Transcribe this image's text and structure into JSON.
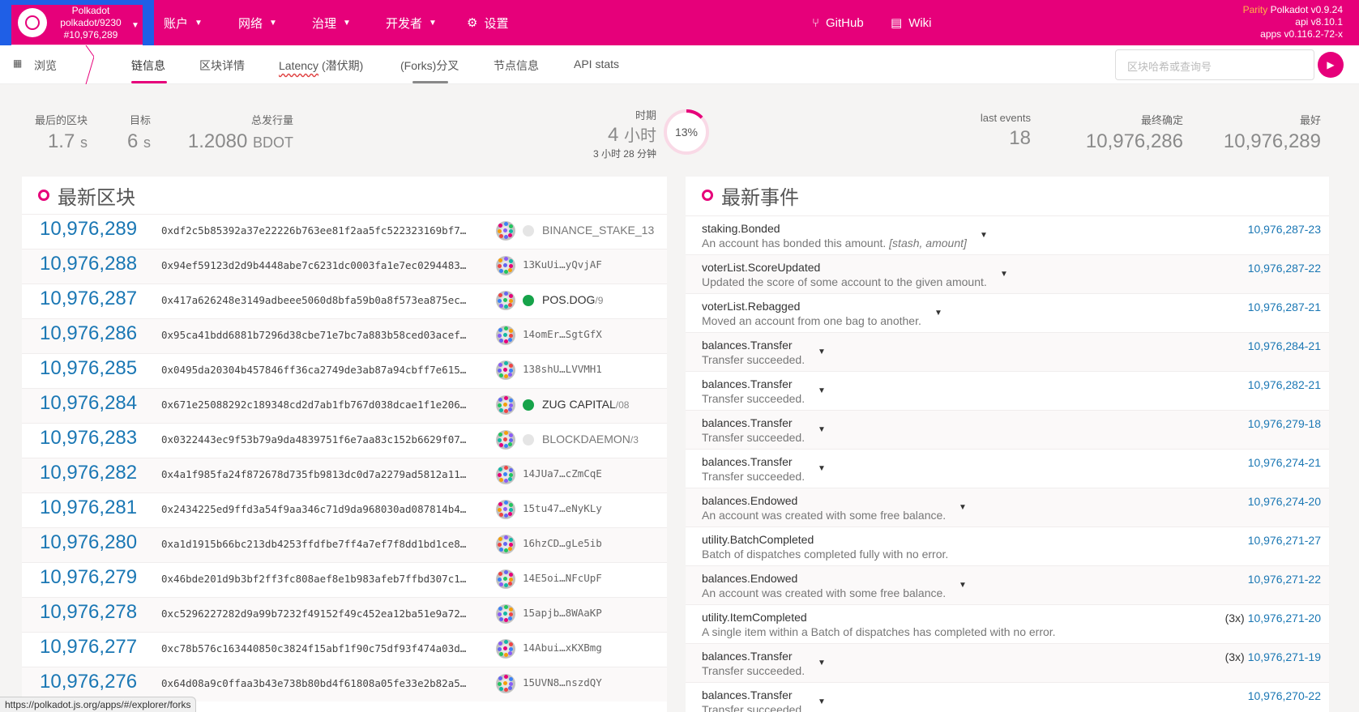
{
  "chain": {
    "name": "Polkadot",
    "endpoint": "polkadot/9230",
    "block": "#10,976,289"
  },
  "nav": {
    "accounts": "账户",
    "network": "网络",
    "governance": "治理",
    "developer": "开发者",
    "settings": "设置",
    "github": "GitHub",
    "wiki": "Wiki"
  },
  "version": {
    "brand": "Parity",
    "node": "Polkadot v0.9.24",
    "api": "api v8.10.1",
    "apps": "apps v0.116.2-72-x"
  },
  "subnav": {
    "browse": "浏览",
    "tabs": [
      {
        "label": "链信息"
      },
      {
        "label": "区块详情"
      },
      {
        "label": "Latency",
        "extra": "(潜伏期)"
      },
      {
        "label": "(Forks)分叉"
      },
      {
        "label": "节点信息"
      },
      {
        "label": "API stats"
      }
    ],
    "search_placeholder": "区块哈希或查询号"
  },
  "summary": {
    "last_block": {
      "label": "最后的区块",
      "value": "1.7",
      "unit": "s"
    },
    "target": {
      "label": "目标",
      "value": "6",
      "unit": "s"
    },
    "issuance": {
      "label": "总发行量",
      "value": "1.2080",
      "unit": "BDOT"
    },
    "era": {
      "label": "时期",
      "value": "4",
      "unit": "小时",
      "sub": "3 小时 28 分钟",
      "percent": 13,
      "percent_label": "13%"
    },
    "last_events": {
      "label": "last events",
      "value": "18"
    },
    "finalized": {
      "label": "最终确定",
      "value": "10,976,286"
    },
    "best": {
      "label": "最好",
      "value": "10,976,289"
    }
  },
  "blocks_title": "最新区块",
  "blocks": [
    {
      "number": "10,976,289",
      "hash": "0xdf2c5b85392a37e22226b763ee81f2aa5fc522323169bf7…",
      "author": "BINANCE_STAKE_13",
      "author_sub": "",
      "type": "named-gray"
    },
    {
      "number": "10,976,288",
      "hash": "0x94ef59123d2d9b4448abe7c6231dc0003fa1e7ec0294483…",
      "author": "13KuUi…yQvjAF",
      "author_sub": "",
      "type": "addr"
    },
    {
      "number": "10,976,287",
      "hash": "0x417a626248e3149adbeee5060d8bfa59b0a8f573ea875ec…",
      "author": "POS.DOG",
      "author_sub": "/9",
      "type": "named-green"
    },
    {
      "number": "10,976,286",
      "hash": "0x95ca41bdd6881b7296d38cbe71e7bc7a883b58ced03acef…",
      "author": "14omEr…SgtGfX",
      "author_sub": "",
      "type": "addr"
    },
    {
      "number": "10,976,285",
      "hash": "0x0495da20304b457846ff36ca2749de3ab87a94cbff7e615…",
      "author": "138shU…LVVMH1",
      "author_sub": "",
      "type": "addr"
    },
    {
      "number": "10,976,284",
      "hash": "0x671e25088292c189348cd2d7ab1fb767d038dcae1f1e206…",
      "author": "ZUG CAPITAL",
      "author_sub": "/08",
      "type": "named-green"
    },
    {
      "number": "10,976,283",
      "hash": "0x0322443ec9f53b79a9da4839751f6e7aa83c152b6629f07…",
      "author": "BLOCKDAEMON",
      "author_sub": "/3",
      "type": "named-gray-link"
    },
    {
      "number": "10,976,282",
      "hash": "0x4a1f985fa24f872678d735fb9813dc0d7a2279ad5812a11…",
      "author": "14JUa7…cZmCqE",
      "author_sub": "",
      "type": "addr"
    },
    {
      "number": "10,976,281",
      "hash": "0x2434225ed9ffd3a54f9aa346c71d9da968030ad087814b4…",
      "author": "15tu47…eNyKLy",
      "author_sub": "",
      "type": "addr"
    },
    {
      "number": "10,976,280",
      "hash": "0xa1d1915b66bc213db4253ffdfbe7ff4a7ef7f8dd1bd1ce8…",
      "author": "16hzCD…gLe5ib",
      "author_sub": "",
      "type": "addr"
    },
    {
      "number": "10,976,279",
      "hash": "0x46bde201d9b3bf2ff3fc808aef8e1b983afeb7ffbd307c1…",
      "author": "14E5oi…NFcUpF",
      "author_sub": "",
      "type": "addr"
    },
    {
      "number": "10,976,278",
      "hash": "0xc5296227282d9a99b7232f49152f49c452ea12ba51e9a72…",
      "author": "15apjb…8WAaKP",
      "author_sub": "",
      "type": "addr"
    },
    {
      "number": "10,976,277",
      "hash": "0xc78b576c163440850c3824f15abf1f90c75df93f474a03d…",
      "author": "14Abui…xKXBmg",
      "author_sub": "",
      "type": "addr"
    },
    {
      "number": "10,976,276",
      "hash": "0x64d08a9c0ffaa3b43e738b80bd4f61808a05fe33e2b82a5…",
      "author": "15UVN8…nszdQY",
      "author_sub": "",
      "type": "addr"
    }
  ],
  "events_title": "最新事件",
  "events": [
    {
      "name": "staking.Bonded",
      "desc": "An account has bonded this amount.",
      "args": "[stash, amount]",
      "ref": "10,976,287-23",
      "count": "",
      "caret": true
    },
    {
      "name": "voterList.ScoreUpdated",
      "desc": "Updated the score of some account to the given amount.",
      "args": "",
      "ref": "10,976,287-22",
      "count": "",
      "caret": true
    },
    {
      "name": "voterList.Rebagged",
      "desc": "Moved an account from one bag to another.",
      "args": "",
      "ref": "10,976,287-21",
      "count": "",
      "caret": true
    },
    {
      "name": "balances.Transfer",
      "desc": "Transfer succeeded.",
      "args": "",
      "ref": "10,976,284-21",
      "count": "",
      "caret": true
    },
    {
      "name": "balances.Transfer",
      "desc": "Transfer succeeded.",
      "args": "",
      "ref": "10,976,282-21",
      "count": "",
      "caret": true
    },
    {
      "name": "balances.Transfer",
      "desc": "Transfer succeeded.",
      "args": "",
      "ref": "10,976,279-18",
      "count": "",
      "caret": true
    },
    {
      "name": "balances.Transfer",
      "desc": "Transfer succeeded.",
      "args": "",
      "ref": "10,976,274-21",
      "count": "",
      "caret": true
    },
    {
      "name": "balances.Endowed",
      "desc": "An account was created with some free balance.",
      "args": "",
      "ref": "10,976,274-20",
      "count": "",
      "caret": true
    },
    {
      "name": "utility.BatchCompleted",
      "desc": "Batch of dispatches completed fully with no error.",
      "args": "",
      "ref": "10,976,271-27",
      "count": "",
      "caret": false
    },
    {
      "name": "balances.Endowed",
      "desc": "An account was created with some free balance.",
      "args": "",
      "ref": "10,976,271-22",
      "count": "",
      "caret": true
    },
    {
      "name": "utility.ItemCompleted",
      "desc": "A single item within a Batch of dispatches has completed with no error.",
      "args": "",
      "ref": "10,976,271-20",
      "count": "(3x)",
      "caret": false
    },
    {
      "name": "balances.Transfer",
      "desc": "Transfer succeeded.",
      "args": "",
      "ref": "10,976,271-19",
      "count": "(3x)",
      "caret": true
    },
    {
      "name": "balances.Transfer",
      "desc": "Transfer succeeded.",
      "args": "",
      "ref": "10,976,270-22",
      "count": "",
      "caret": true
    }
  ],
  "status_url": "https://polkadot.js.org/apps/#/explorer/forks",
  "colors": {
    "brand": "#e6007a",
    "highlight": "#1f5fe6",
    "link": "#1a77b4"
  }
}
